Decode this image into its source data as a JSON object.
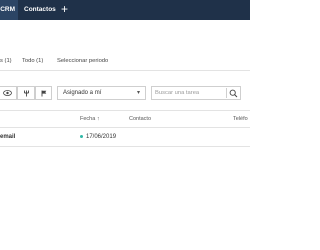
{
  "topbar": {
    "tab_crm": "CRM",
    "tab_contactos": "Contactos",
    "add_label": "+"
  },
  "filters": {
    "item1": "s (1)",
    "item2": "Todo (1)",
    "item3": "Seleccionar periodo"
  },
  "toolbar": {
    "assigned_select": "Asignado a mí",
    "search_placeholder": "Buscar una tarea",
    "icons": [
      "eye-icon",
      "fork-icon",
      "flag-icon",
      "chevron-down-icon",
      "search-icon"
    ]
  },
  "table": {
    "columns": [
      "Fecha ↑",
      "Contacto",
      "Teléfo"
    ],
    "rows": [
      {
        "title": "email",
        "date": "17/06/2019",
        "status_color": "#2fb8a6"
      }
    ]
  },
  "colors": {
    "topbar": "#1f3149",
    "active_tab": "#2c4565",
    "status_dot": "#2fb8a6"
  }
}
